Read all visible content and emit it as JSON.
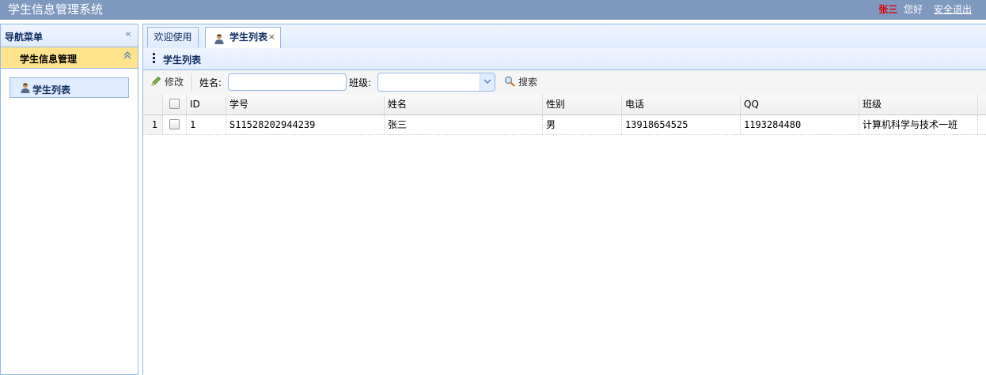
{
  "header": {
    "app_title": "学生信息管理系统",
    "user_name": "张三",
    "greeting": "您好",
    "logout_label": "安全退出"
  },
  "sidebar": {
    "title": "导航菜单",
    "collapse_icon": "double-chevron-left-icon",
    "accordion": {
      "title": "学生信息管理",
      "toggle_icon": "double-chevron-up-icon",
      "items": [
        {
          "label": "学生列表",
          "icon": "user-icon"
        }
      ]
    }
  },
  "tabs": [
    {
      "label": "欢迎使用",
      "active": false
    },
    {
      "label": "学生列表",
      "icon": "user-icon",
      "active": true,
      "close": "×"
    }
  ],
  "panel": {
    "title": "学生列表"
  },
  "toolbar": {
    "edit_label": "修改",
    "name_label": "姓名:",
    "name_value": "",
    "class_label": "班级:",
    "class_value": "",
    "search_label": "搜索"
  },
  "grid": {
    "columns": [
      "ID",
      "学号",
      "姓名",
      "性别",
      "电话",
      "QQ",
      "班级"
    ],
    "rows": [
      {
        "rownum": "1",
        "id": "1",
        "sn": "S11528202944239",
        "name": "张三",
        "gender": "男",
        "phone": "13918654525",
        "qq": "1193284480",
        "class": "计算机科学与技术一班"
      }
    ]
  },
  "colors": {
    "header_bg": "#7f99be",
    "border": "#95b8e7",
    "accordion_active": "#ffe48d",
    "user_name": "#e00000"
  }
}
